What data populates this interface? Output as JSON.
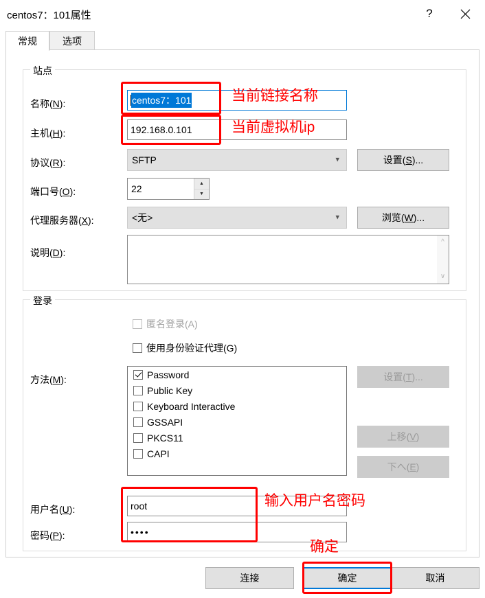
{
  "window": {
    "title": "centos7：101属性",
    "help_button": "?",
    "close_button": "✕"
  },
  "tabs": [
    {
      "label": "常规",
      "active": true
    },
    {
      "label": "选项",
      "active": false
    }
  ],
  "site_group": {
    "title": "站点",
    "name_label": "名称(N):",
    "name_value": "centos7：101",
    "host_label": "主机(H):",
    "host_value": "192.168.0.101",
    "protocol_label": "协议(R):",
    "protocol_value": "SFTP",
    "protocol_settings_button": "设置(S)...",
    "port_label": "端口号(O):",
    "port_value": "22",
    "proxy_label": "代理服务器(X):",
    "proxy_value": "<无>",
    "proxy_browse_button": "浏览(W)...",
    "description_label": "说明(D):",
    "description_value": ""
  },
  "login_group": {
    "title": "登录",
    "anonymous_label": "匿名登录(A)",
    "anonymous_checked": false,
    "anonymous_disabled": true,
    "auth_agent_label": "使用身份验证代理(G)",
    "auth_agent_checked": false,
    "methods_label": "方法(M):",
    "methods": [
      {
        "label": "Password",
        "checked": true
      },
      {
        "label": "Public Key",
        "checked": false
      },
      {
        "label": "Keyboard Interactive",
        "checked": false
      },
      {
        "label": "GSSAPI",
        "checked": false
      },
      {
        "label": "PKCS11",
        "checked": false
      },
      {
        "label": "CAPI",
        "checked": false
      }
    ],
    "method_settings_button": "设置(T)...",
    "move_up_button": "上移(V)",
    "move_down_button": "下へ(E)",
    "username_label": "用户名(U):",
    "username_value": "root",
    "password_label": "密码(P):",
    "password_value": "••••"
  },
  "footer": {
    "connect_button": "连接",
    "ok_button": "确定",
    "cancel_button": "取消"
  },
  "annotations": {
    "color": "#ff0000",
    "name_note": "当前链接名称",
    "host_note": "当前虚拟机ip",
    "credentials_note": "输入用户名密码",
    "ok_note": "确定"
  }
}
